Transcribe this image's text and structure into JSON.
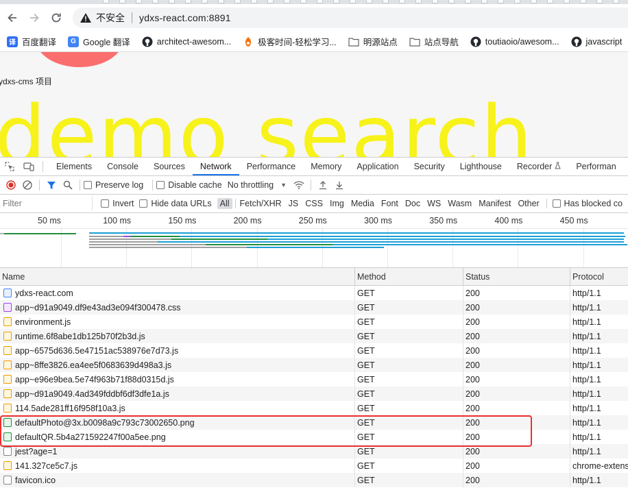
{
  "browser": {
    "security_label": "不安全",
    "url": "ydxs-react.com:8891",
    "bookmarks": [
      {
        "label": "百度翻译",
        "icon": "baidu-translate-icon",
        "color": "#2f6ef5"
      },
      {
        "label": "Google 翻译",
        "icon": "google-translate-icon",
        "color": "#4285f4"
      },
      {
        "label": "architect-awesom...",
        "icon": "github-icon",
        "color": "#24292f"
      },
      {
        "label": "极客时间-轻松学习...",
        "icon": "geektime-icon",
        "color": "#f5730f"
      },
      {
        "label": "明源站点",
        "icon": "folder-icon",
        "color": "#5f6368"
      },
      {
        "label": "站点导航",
        "icon": "folder-icon",
        "color": "#5f6368"
      },
      {
        "label": "toutiaoio/awesom...",
        "icon": "github-icon",
        "color": "#24292f"
      },
      {
        "label": "javascript",
        "icon": "github-icon",
        "color": "#24292f"
      }
    ]
  },
  "page": {
    "title": "ydxs-cms 项目",
    "big_text": "demo search",
    "big_text_color": "#f7f21a"
  },
  "devtools": {
    "tabs": [
      "Elements",
      "Console",
      "Sources",
      "Network",
      "Performance",
      "Memory",
      "Application",
      "Security",
      "Lighthouse",
      "Recorder",
      "Performan"
    ],
    "active_tab": "Network",
    "toolbar": {
      "preserve_log": "Preserve log",
      "disable_cache": "Disable cache",
      "throttling": "No throttling"
    },
    "filter": {
      "placeholder": "Filter",
      "invert": "Invert",
      "hide_data_urls": "Hide data URLs",
      "types": [
        "All",
        "Fetch/XHR",
        "JS",
        "CSS",
        "Img",
        "Media",
        "Font",
        "Doc",
        "WS",
        "Wasm",
        "Manifest",
        "Other"
      ],
      "active_type": "All",
      "has_blocked": "Has blocked co"
    },
    "timeline": {
      "ticks": [
        "50 ms",
        "100 ms",
        "150 ms",
        "200 ms",
        "250 ms",
        "300 ms",
        "350 ms",
        "400 ms",
        "450 ms",
        "50"
      ]
    },
    "table": {
      "columns": [
        "Name",
        "Method",
        "Status",
        "Protocol"
      ],
      "rows": [
        {
          "name": "ydxs-react.com",
          "type": "doc",
          "method": "GET",
          "status": "200",
          "protocol": "http/1.1"
        },
        {
          "name": "app~d91a9049.df9e43ad3e094f300478.css",
          "type": "css",
          "method": "GET",
          "status": "200",
          "protocol": "http/1.1"
        },
        {
          "name": "environment.js",
          "type": "js",
          "method": "GET",
          "status": "200",
          "protocol": "http/1.1"
        },
        {
          "name": "runtime.6f8abe1db125b70f2b3d.js",
          "type": "js",
          "method": "GET",
          "status": "200",
          "protocol": "http/1.1"
        },
        {
          "name": "app~6575d636.5e47151ac538976e7d73.js",
          "type": "js",
          "method": "GET",
          "status": "200",
          "protocol": "http/1.1"
        },
        {
          "name": "app~8ffe3826.ea4ee5f0683639d498a3.js",
          "type": "js",
          "method": "GET",
          "status": "200",
          "protocol": "http/1.1"
        },
        {
          "name": "app~e96e9bea.5e74f963b71f88d0315d.js",
          "type": "js",
          "method": "GET",
          "status": "200",
          "protocol": "http/1.1"
        },
        {
          "name": "app~d91a9049.4ad349fddbf6df3dfe1a.js",
          "type": "js",
          "method": "GET",
          "status": "200",
          "protocol": "http/1.1"
        },
        {
          "name": "114.5ade281ff16f958f10a3.js",
          "type": "js",
          "method": "GET",
          "status": "200",
          "protocol": "http/1.1"
        },
        {
          "name": "defaultPhoto@3x.b0098a9c793c73002650.png",
          "type": "img",
          "method": "GET",
          "status": "200",
          "protocol": "http/1.1"
        },
        {
          "name": "defaultQR.5b4a271592247f00a5ee.png",
          "type": "img",
          "method": "GET",
          "status": "200",
          "protocol": "http/1.1"
        },
        {
          "name": "jest?age=1",
          "type": "other",
          "method": "GET",
          "status": "200",
          "protocol": "http/1.1"
        },
        {
          "name": "141.327ce5c7.js",
          "type": "js",
          "method": "GET",
          "status": "200",
          "protocol": "chrome-extens"
        },
        {
          "name": "favicon.ico",
          "type": "other",
          "method": "GET",
          "status": "200",
          "protocol": "http/1.1"
        }
      ]
    }
  }
}
